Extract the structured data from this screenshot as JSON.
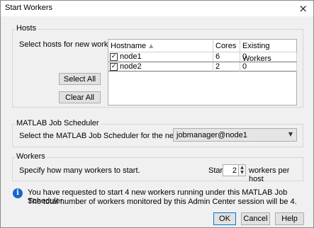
{
  "window": {
    "title": "Start Workers",
    "close_glyph": "×"
  },
  "hosts": {
    "group_title": "Hosts",
    "prompt": "Select hosts for new workers.",
    "select_all_label": "Select All",
    "clear_all_label": "Clear All",
    "table": {
      "columns": [
        "Hostname",
        "Cores",
        "Existing Workers"
      ],
      "sort_indicator": "▲",
      "rows": [
        {
          "checked": true,
          "check_glyph": "✓",
          "hostname": "node1",
          "cores": "6",
          "existing_workers": "0"
        },
        {
          "checked": true,
          "check_glyph": "✓",
          "hostname": "node2",
          "cores": "2",
          "existing_workers": "0"
        }
      ]
    }
  },
  "scheduler": {
    "group_title": "MATLAB Job Scheduler",
    "prompt": "Select the MATLAB Job Scheduler for the new workers.",
    "selected": "jobmanager@node1",
    "arrow_glyph": "▼"
  },
  "workers": {
    "group_title": "Workers",
    "prompt": "Specify how many workers to start.",
    "start_label": "Start",
    "count": "2",
    "per_host_label": "workers per host",
    "up_glyph": "▲",
    "down_glyph": "▼"
  },
  "info": {
    "icon": "info-icon",
    "icon_glyph": "i",
    "line1": "You have requested to start 4 new workers running under this MATLAB Job Scheduler.",
    "line2": "The total number of workers monitored by this Admin Center session will be 4."
  },
  "footer": {
    "ok_label": "OK",
    "cancel_label": "Cancel",
    "help_label": "Help"
  },
  "colors": {
    "accent": "#0078d7",
    "info": "#1a66c9",
    "dialog_bg": "#f0f0f0"
  }
}
